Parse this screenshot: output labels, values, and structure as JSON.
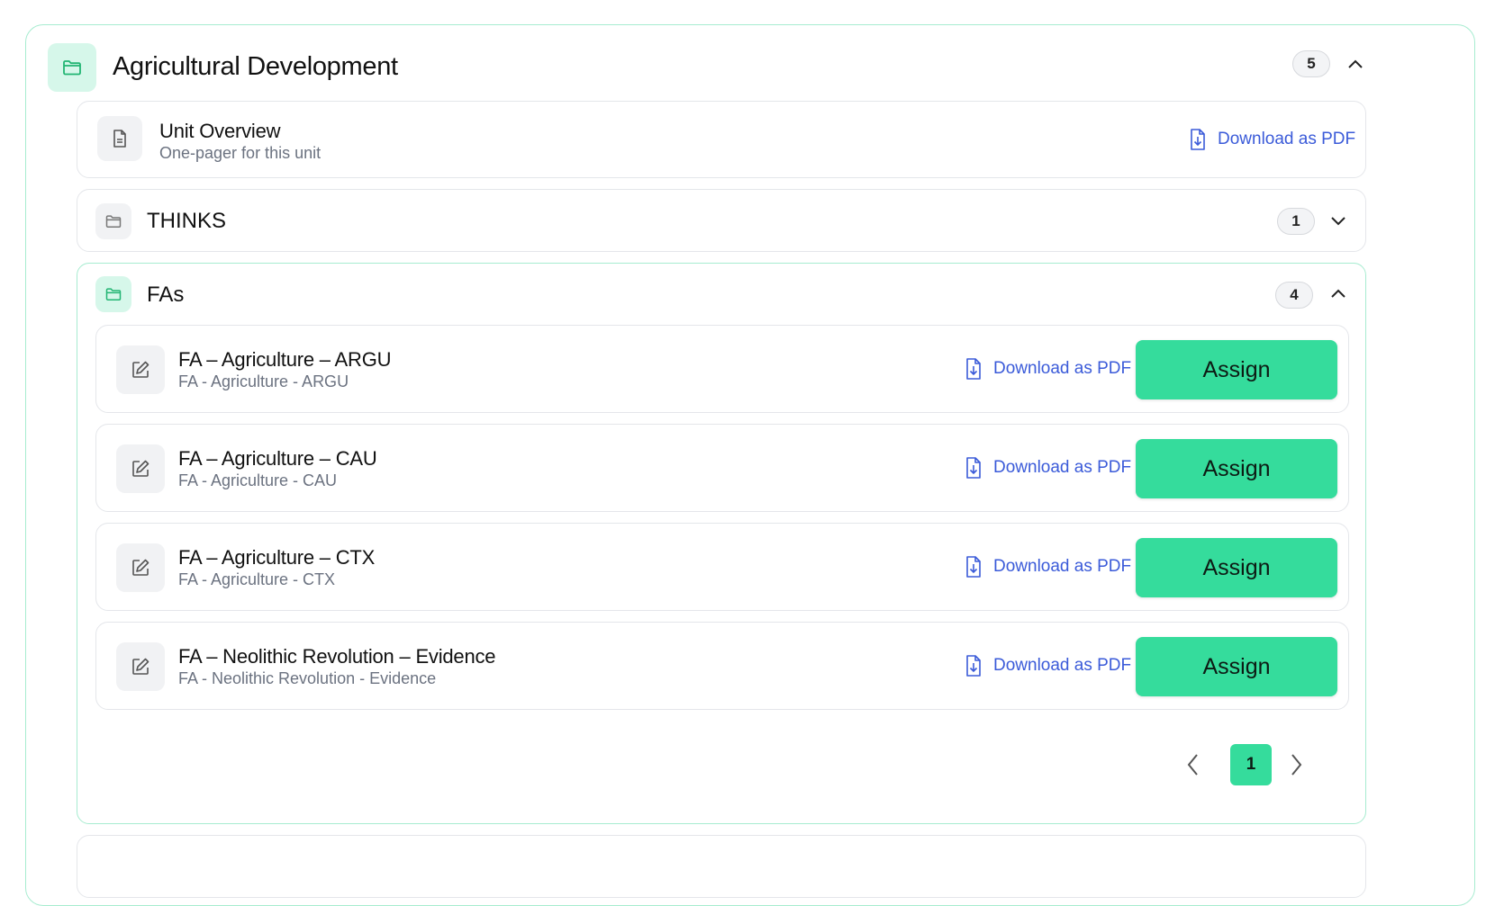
{
  "unit": {
    "title": "Agricultural Development",
    "count": "5"
  },
  "overview": {
    "title": "Unit Overview",
    "subtitle": "One-pager for this unit",
    "download_label": "Download as PDF"
  },
  "sections": [
    {
      "title": "THINKS",
      "count": "1"
    },
    {
      "title": "FAs",
      "count": "4"
    }
  ],
  "items": [
    {
      "title": "FA – Agriculture – ARGU",
      "subtitle": "FA - Agriculture - ARGU",
      "download_label": "Download as PDF",
      "assign_label": "Assign"
    },
    {
      "title": "FA – Agriculture – CAU",
      "subtitle": "FA - Agriculture - CAU",
      "download_label": "Download as PDF",
      "assign_label": "Assign"
    },
    {
      "title": "FA – Agriculture – CTX",
      "subtitle": "FA - Agriculture - CTX",
      "download_label": "Download as PDF",
      "assign_label": "Assign"
    },
    {
      "title": "FA – Neolithic Revolution – Evidence",
      "subtitle": "FA - Neolithic Revolution - Evidence",
      "download_label": "Download as PDF",
      "assign_label": "Assign"
    }
  ],
  "pagination": {
    "current": "1"
  },
  "colors": {
    "accent": "#35dc9c",
    "accent_light": "#d6f7ea",
    "link": "#3b5bd9",
    "border_green": "#a7ecd0"
  },
  "icons": [
    "folder-icon",
    "document-icon",
    "edit-icon",
    "file-download-icon",
    "chevron-up-icon",
    "chevron-down-icon",
    "chevron-left-icon",
    "chevron-right-icon"
  ]
}
